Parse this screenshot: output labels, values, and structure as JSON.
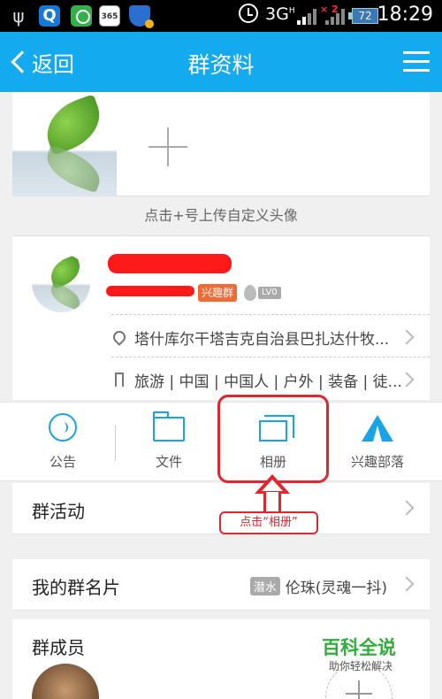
{
  "statusbar": {
    "network": "3G",
    "signal_sup": "H",
    "signal2_sup": "2",
    "battery": "72",
    "time": "18:29",
    "icons": [
      "usb-icon",
      "qq-browser-icon",
      "wechat-icon",
      "calendar-365-icon",
      "security-shield-icon",
      "alarm-icon"
    ]
  },
  "navbar": {
    "back_label": "返回",
    "title": "群资料"
  },
  "avatar": {
    "upload_hint": "点击+号上传自定义头像"
  },
  "group": {
    "tag": "兴趣群",
    "level": "LV0",
    "location": "塔什库尔干塔吉克自治县巴扎达什牧...",
    "tags": "旅游 | 中国 | 中国人 | 户外 | 装备 | 徒..."
  },
  "actions": [
    {
      "label": "公告"
    },
    {
      "label": "文件"
    },
    {
      "label": "相册"
    },
    {
      "label": "兴趣部落"
    }
  ],
  "annotation": {
    "hint": "点击“相册”",
    "color": "#e3262e"
  },
  "rows": {
    "activities": "群活动",
    "my_card": "我的群名片",
    "my_card_badge": "潜水",
    "my_card_value": "伦珠(灵魂一抖)",
    "members": "群成员"
  },
  "watermark": {
    "title": "百科全说",
    "subtitle": "助你轻松解决"
  },
  "colors": {
    "navbar": "#14aaf0",
    "accent": "#1aa4e8",
    "interest_tag": "#f06a35"
  }
}
